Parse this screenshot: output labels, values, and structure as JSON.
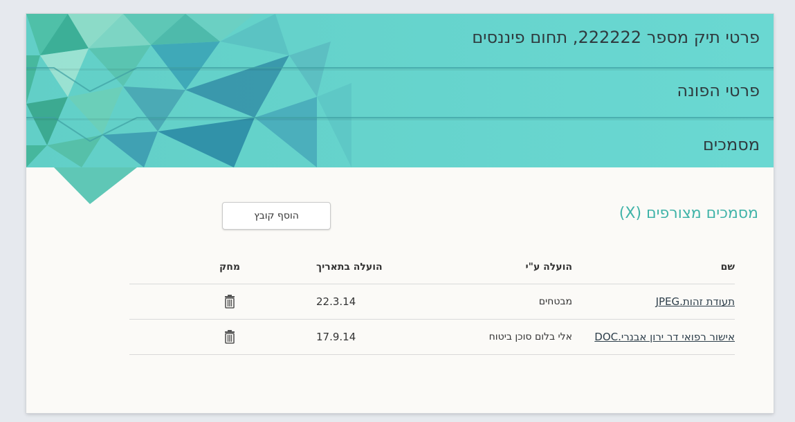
{
  "bars": {
    "case_details": "פרטי תיק מספר 222222, תחום פיננסים",
    "applicant_details": "פרטי הפונה",
    "documents": "מסמכים"
  },
  "documents_section": {
    "title": "מסמכים מצורפים (X)",
    "add_file_label": "הוסף קובץ",
    "columns": {
      "name": "שם",
      "uploaded_by": "הועלה ע\"י",
      "uploaded_date": "הועלה בתאריך",
      "delete": "מחק"
    },
    "rows": [
      {
        "name": "תעודת זהות.JPEG",
        "uploaded_by": "מבטחים",
        "date": "22.3.14"
      },
      {
        "name": "אישור רפואי דר ירון אבנרי.DOC",
        "uploaded_by": "אלי בלום סוכן ביטוח",
        "date": "17.9.14"
      }
    ]
  },
  "colors": {
    "bar_teal": "#6fd8d2",
    "accent_title": "#3fb3a8",
    "card_bg": "#fbfaf7"
  },
  "icons": {
    "delete": "trash-icon"
  }
}
